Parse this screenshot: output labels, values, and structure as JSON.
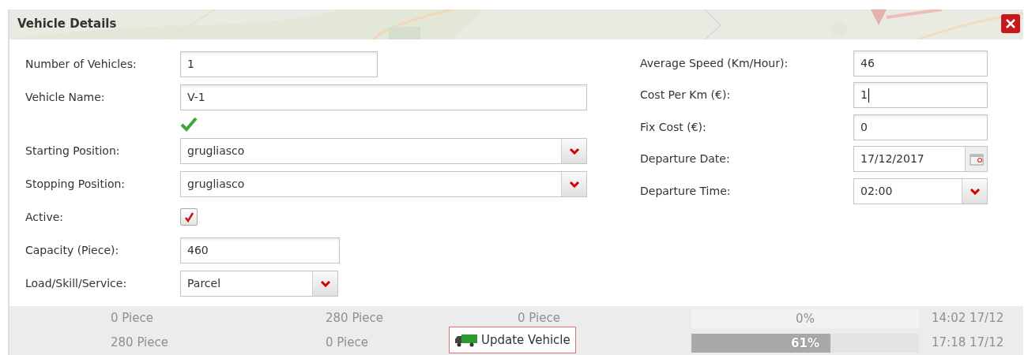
{
  "dialog": {
    "title": "Vehicle Details"
  },
  "left_fields": [
    {
      "kind": "text",
      "label": "Number of Vehicles:",
      "value": "1"
    },
    {
      "kind": "text",
      "label": "Vehicle Name:",
      "value": "V-1",
      "valid": true
    },
    {
      "kind": "select",
      "label": "Starting Position:",
      "value": "grugliasco"
    },
    {
      "kind": "select",
      "label": "Stopping Position:",
      "value": "grugliasco"
    },
    {
      "kind": "checkbox",
      "label": "Active:",
      "checked": true
    },
    {
      "kind": "text",
      "label": "Capacity (Piece):",
      "value": "460"
    },
    {
      "kind": "select",
      "label": "Load/Skill/Service:",
      "value": "Parcel"
    }
  ],
  "right_fields": [
    {
      "kind": "text",
      "label": "Average Speed (Km/Hour):",
      "value": "46",
      "focused": false
    },
    {
      "kind": "text",
      "label": "Cost Per Km (€):",
      "value": "1",
      "focused": true
    },
    {
      "kind": "text",
      "label": "Fix Cost (€):",
      "value": "0",
      "focused": false
    },
    {
      "kind": "date",
      "label": "Departure Date:",
      "value": "17/12/2017",
      "focused": false
    },
    {
      "kind": "select",
      "label": "Departure Time:",
      "value": "02:00",
      "focused": false
    }
  ],
  "update_button": {
    "label": "Update Vehicle"
  },
  "background_table": {
    "rows": [
      {
        "cells": [
          "0 Piece",
          "280 Piece",
          "0 Piece"
        ],
        "progress": {
          "level": 0,
          "reading": "0%"
        },
        "time": "14:02 17/12"
      },
      {
        "cells": [
          "280 Piece",
          "0 Piece"
        ],
        "progress": {
          "level": 0.61,
          "reading": "61%"
        },
        "time": "17:18 17/12"
      }
    ]
  }
}
